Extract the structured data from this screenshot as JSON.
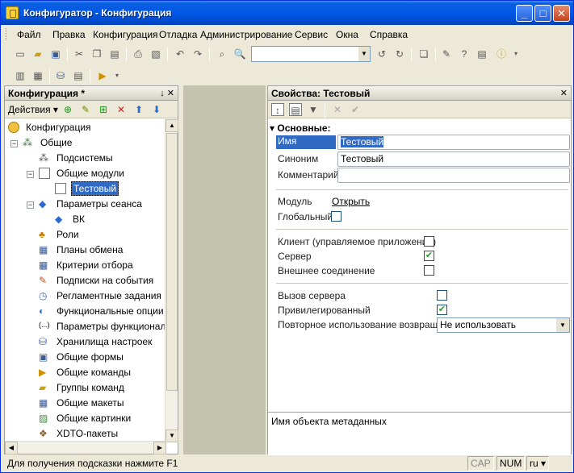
{
  "window": {
    "title": "Конфигуратор - Конфигурация",
    "minimize": "_",
    "maximize": "□",
    "close": "✕"
  },
  "menu": [
    "Файл",
    "Правка",
    "Конфигурация",
    "Отладка",
    "Администрирование",
    "Сервис",
    "Окна",
    "Справка"
  ],
  "left_panel": {
    "title": "Конфигурация *",
    "header_buttons": "↓  ✕",
    "actions_label": "Действия ▾",
    "tree": [
      {
        "label": "Конфигурация",
        "icon": "config-icon"
      },
      {
        "label": "Общие",
        "icon": "common-icon",
        "expand": "−"
      },
      {
        "label": "Подсистемы",
        "icon": "subsystems-icon"
      },
      {
        "label": "Общие модули",
        "icon": "module-icon",
        "expand": "−"
      },
      {
        "label": "Тестовый",
        "icon": "module-item-icon",
        "selected": true
      },
      {
        "label": "Параметры сеанса",
        "icon": "session-param-icon",
        "expand": "−"
      },
      {
        "label": "ВК",
        "icon": "session-param-item-icon"
      },
      {
        "label": "Роли",
        "icon": "role-icon"
      },
      {
        "label": "Планы обмена",
        "icon": "exchange-plan-icon"
      },
      {
        "label": "Критерии отбора",
        "icon": "filter-criteria-icon"
      },
      {
        "label": "Подписки на события",
        "icon": "event-subscription-icon"
      },
      {
        "label": "Регламентные задания",
        "icon": "scheduled-job-icon"
      },
      {
        "label": "Функциональные опции",
        "icon": "functional-option-icon"
      },
      {
        "label": "Параметры функциональн",
        "icon": "functional-param-icon"
      },
      {
        "label": "Хранилища настроек",
        "icon": "settings-storage-icon"
      },
      {
        "label": "Общие формы",
        "icon": "common-form-icon"
      },
      {
        "label": "Общие команды",
        "icon": "common-command-icon"
      },
      {
        "label": "Группы команд",
        "icon": "command-group-icon"
      },
      {
        "label": "Общие макеты",
        "icon": "common-template-icon"
      },
      {
        "label": "Общие картинки",
        "icon": "common-picture-icon"
      },
      {
        "label": "XDTO-пакеты",
        "icon": "xdto-icon"
      }
    ]
  },
  "right_panel": {
    "title": "Свойства: Тестовый",
    "close": "✕",
    "section": "Основные:",
    "fields": {
      "name_label": "Имя",
      "name_value": "Тестовый",
      "synonym_label": "Синоним",
      "synonym_value": "Тестовый",
      "comment_label": "Комментарий",
      "comment_value": "",
      "module_label": "Модуль",
      "module_link": "Открыть",
      "global_label": "Глобальный",
      "client_label": "Клиент (управляемое приложение)",
      "server_label": "Сервер",
      "external_label": "Внешнее соединение",
      "server_call_label": "Вызов сервера",
      "privileged_label": "Привилегированный",
      "reuse_label": "Повторное использование возвращае",
      "reuse_value": "Не использовать"
    },
    "checks": {
      "global": false,
      "client": false,
      "server": true,
      "external": false,
      "server_call": false,
      "privileged": true
    },
    "description": "Имя объекта метаданных"
  },
  "status": {
    "hint": "Для получения подсказки нажмите F1",
    "cap": "CAP",
    "num": "NUM",
    "lang": "ru ▾"
  }
}
